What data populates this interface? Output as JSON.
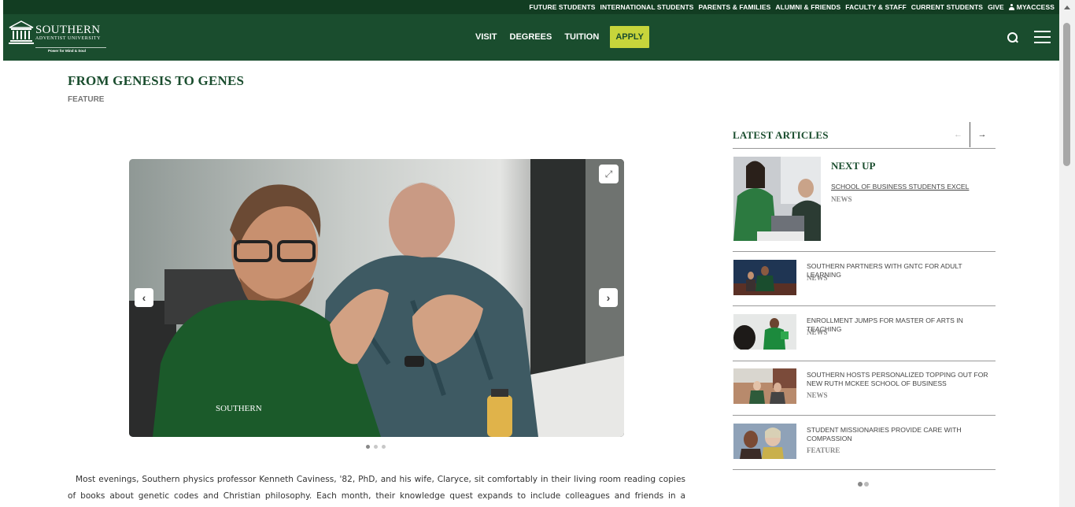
{
  "utility_nav": {
    "links": [
      "FUTURE STUDENTS",
      "INTERNATIONAL STUDENTS",
      "PARENTS & FAMILIES",
      "ALUMNI & FRIENDS",
      "FACULTY & STAFF",
      "CURRENT STUDENTS",
      "GIVE"
    ],
    "myaccess": "MYACCESS"
  },
  "brand": {
    "name": "SOUTHERN",
    "subname": "ADVENTIST UNIVERSITY",
    "tagline": "Power for Mind & Soul",
    "green": "#1a4d2e",
    "dark_green": "#123d22",
    "accent": "#c7d53b"
  },
  "main_nav": {
    "items": [
      "VISIT",
      "DEGREES",
      "TUITION"
    ],
    "apply": "APPLY"
  },
  "article": {
    "title": "FROM GENESIS TO GENES",
    "category": "FEATURE",
    "slides_total": 3,
    "slide_active": 1,
    "body": "Most evenings, Southern physics professor Kenneth Caviness, '82, PhD, and his wife, Claryce, sit comfortably in their living room reading copies of books about genetic codes and Christian philosophy. Each month, their knowledge quest expands to include colleagues and friends in a conference room on"
  },
  "sidebar": {
    "header": "LATEST ARTICLES",
    "next_up": {
      "label": "NEXT UP",
      "title": "SCHOOL OF BUSINESS STUDENTS EXCEL",
      "category": "NEWS"
    },
    "articles": [
      {
        "title": "SOUTHERN PARTNERS WITH GNTC FOR ADULT LEARNING",
        "category": "NEWS"
      },
      {
        "title": "ENROLLMENT JUMPS FOR MASTER OF ARTS IN TEACHING",
        "category": "NEWS"
      },
      {
        "title": "SOUTHERN HOSTS PERSONALIZED TOPPING OUT FOR NEW RUTH MCKEE SCHOOL OF BUSINESS",
        "category": "NEWS"
      },
      {
        "title": "STUDENT MISSIONARIES PROVIDE CARE WITH COMPASSION",
        "category": "FEATURE"
      }
    ],
    "pages_total": 2,
    "page_active": 1
  }
}
